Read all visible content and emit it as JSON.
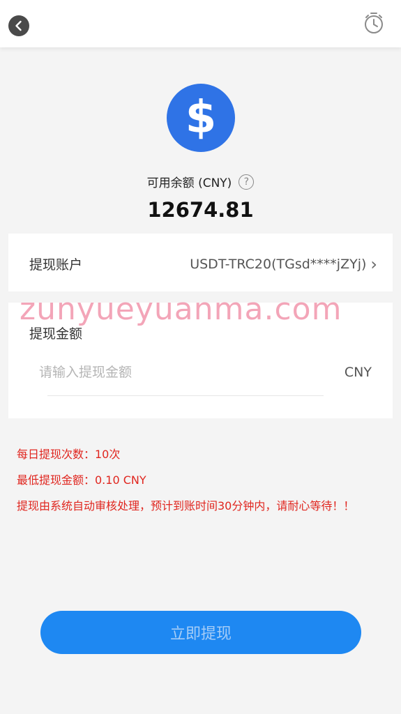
{
  "header": {
    "back_icon": "chevron-left-icon",
    "history_icon": "timer-history-icon"
  },
  "balance": {
    "coin_icon": "dollar-icon",
    "label": "可用余额 (CNY)",
    "help_icon": "question-circle-icon",
    "help_glyph": "?",
    "value": "12674.81",
    "accent_color": "#2f73e6"
  },
  "account": {
    "label": "提现账户",
    "value": "USDT-TRC20(TGsd****jZYj)",
    "chevron": "›"
  },
  "amount": {
    "label": "提现金额",
    "placeholder": "请输入提现金额",
    "value": "",
    "unit": "CNY"
  },
  "watermark": "zunyueyuanma.com",
  "notes": [
    "每日提现次数：10次",
    "最低提现金额：0.10 CNY",
    "提现由系统自动审核处理，预计到账时间30分钟内，请耐心等待！！"
  ],
  "submit": {
    "label": "立即提现",
    "color": "#1e88f2"
  },
  "colors": {
    "notice_red": "#e0261f",
    "background": "#f4f4f4"
  }
}
